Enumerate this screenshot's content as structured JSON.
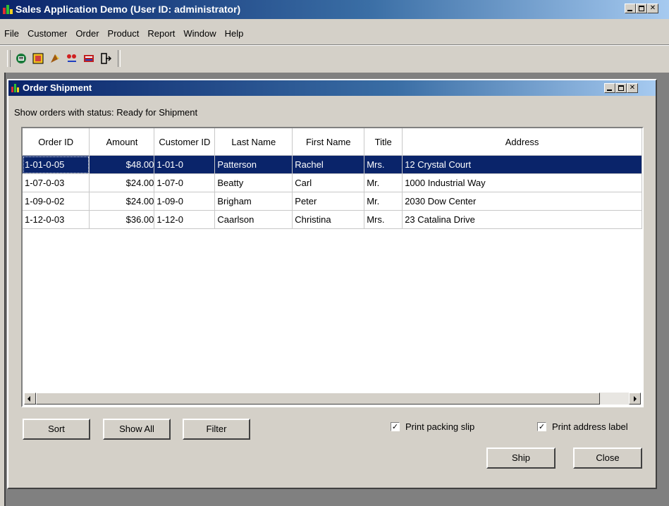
{
  "app": {
    "title": "Sales Application Demo (User ID: administrator)"
  },
  "menu": [
    "File",
    "Customer",
    "Order",
    "Product",
    "Report",
    "Window",
    "Help"
  ],
  "toolbar": {
    "icons": [
      "customer-icon",
      "order-icon",
      "product-icon",
      "report-icon",
      "window-icon",
      "exit-icon"
    ]
  },
  "window": {
    "title": "Order Shipment",
    "filter_label": "Show orders with status: Ready for Shipment"
  },
  "table": {
    "columns": [
      "Order ID",
      "Amount",
      "Customer ID",
      "Last Name",
      "First Name",
      "Title",
      "Address"
    ],
    "rows": [
      [
        "1-01-0-05",
        "$48.00",
        "1-01-0",
        "Patterson",
        "Rachel",
        "Mrs.",
        "12 Crystal Court"
      ],
      [
        "1-07-0-03",
        "$24.00",
        "1-07-0",
        "Beatty",
        "Carl",
        "Mr.",
        "1000 Industrial Way"
      ],
      [
        "1-09-0-02",
        "$24.00",
        "1-09-0",
        "Brigham",
        "Peter",
        "Mr.",
        "2030 Dow Center"
      ],
      [
        "1-12-0-03",
        "$36.00",
        "1-12-0",
        "Caarlson",
        "Christina",
        "Mrs.",
        "23 Catalina Drive"
      ]
    ],
    "selected_row": 0
  },
  "buttons": {
    "sort": "Sort",
    "show_all": "Show All",
    "filter": "Filter",
    "ship": "Ship",
    "close": "Close"
  },
  "options": {
    "print_packing_slip": {
      "label": "Print packing slip",
      "checked": true
    },
    "print_address_label": {
      "label": "Print address label",
      "checked": true
    }
  },
  "colors": {
    "title_bar": "#0a246a",
    "selection": "#0a246a",
    "face": "#d4d0c8"
  }
}
